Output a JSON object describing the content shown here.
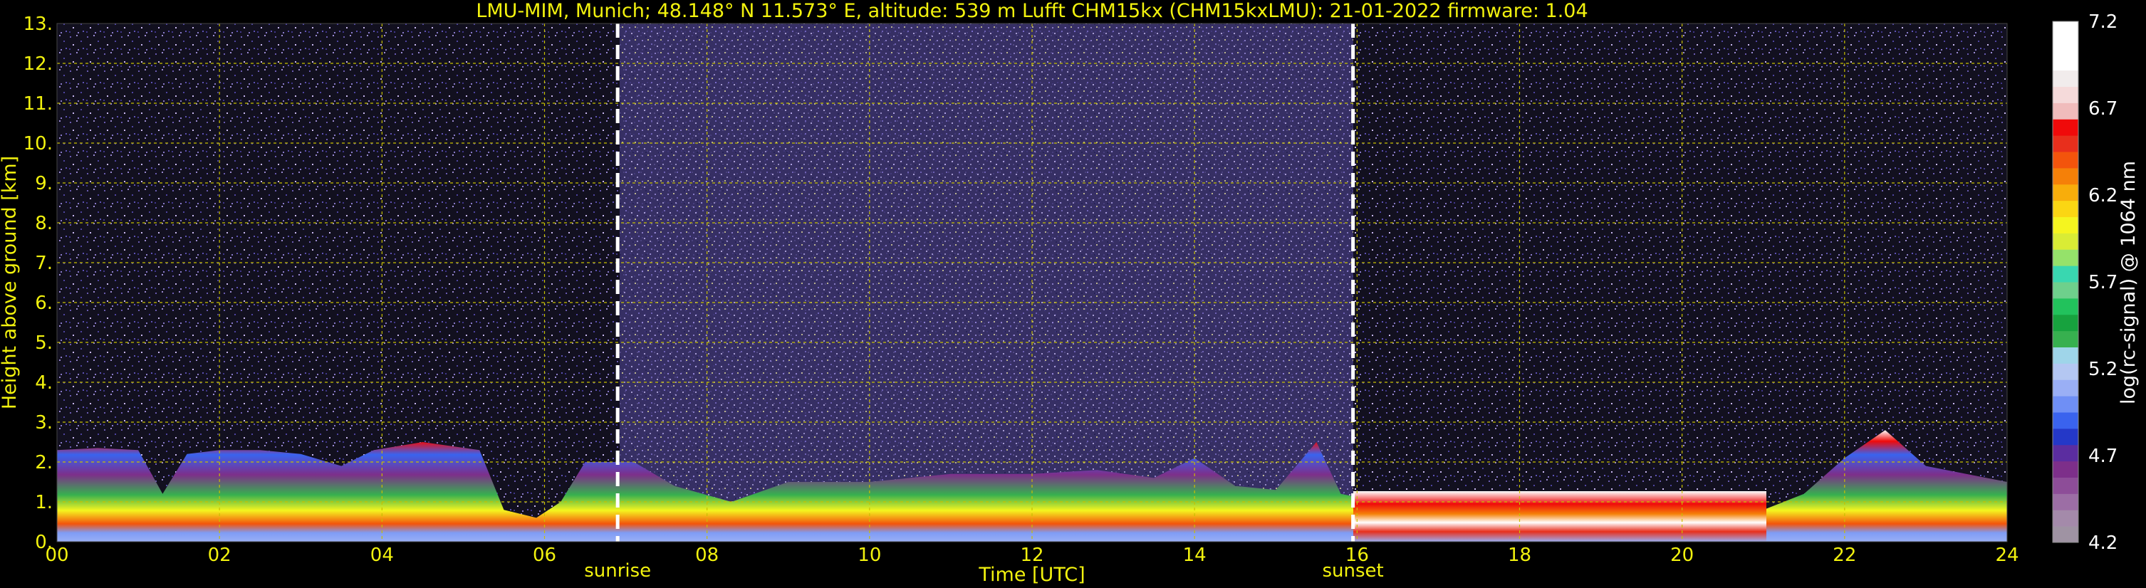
{
  "chart_data": {
    "type": "heatmap",
    "title": "LMU-MIM, Munich; 48.148° N 11.573° E, altitude: 539 m    Lufft CHM15kx (CHM15kxLMU): 21-01-2022    firmware: 1.04",
    "xlabel": "Time [UTC]",
    "ylabel": "Height above ground [km]",
    "xlim": [
      0,
      24
    ],
    "ylim": [
      0,
      13
    ],
    "x_ticks": [
      "00",
      "02",
      "04",
      "06",
      "08",
      "10",
      "12",
      "14",
      "16",
      "18",
      "20",
      "22",
      "24"
    ],
    "y_ticks": [
      "0.",
      "1.",
      "2.",
      "3.",
      "4.",
      "5.",
      "6.",
      "7.",
      "8.",
      "9.",
      "10.",
      "11.",
      "12.",
      "13."
    ],
    "grid": true,
    "annotations": [
      {
        "x": 6.9,
        "label": "sunrise"
      },
      {
        "x": 15.95,
        "label": "sunset"
      }
    ],
    "colorbar": {
      "label": "log(rc-signal) @ 1064 nm",
      "range": [
        4.2,
        7.2
      ],
      "ticks": [
        "4.2",
        "4.7",
        "5.2",
        "5.7",
        "6.2",
        "6.7",
        "7.2"
      ],
      "colors": [
        "#9f93a3",
        "#a48aaa",
        "#9c6ea5",
        "#8d4d98",
        "#7d2f8a",
        "#5b2da0",
        "#2438c8",
        "#3a63ee",
        "#6f8ff5",
        "#9aaff5",
        "#b4c7f2",
        "#9fd5e9",
        "#37b04f",
        "#17a23e",
        "#22c25c",
        "#6ed08c",
        "#39d7b0",
        "#95e26a",
        "#d9ec35",
        "#f5f51f",
        "#fbd613",
        "#f8ad0b",
        "#f58008",
        "#f3540c",
        "#e82f1c",
        "#f00a0a",
        "#f0bcbc",
        "#f5dada",
        "#f1ecec",
        "#ffffff",
        "#ffffff",
        "#ffffff"
      ]
    },
    "boundary_layer_top_km": [
      [
        0.0,
        2.3
      ],
      [
        0.5,
        2.35
      ],
      [
        1.0,
        2.3
      ],
      [
        1.3,
        1.2
      ],
      [
        1.6,
        2.2
      ],
      [
        2.0,
        2.3
      ],
      [
        2.5,
        2.3
      ],
      [
        3.0,
        2.2
      ],
      [
        3.5,
        1.9
      ],
      [
        3.9,
        2.3
      ],
      [
        4.5,
        2.5
      ],
      [
        5.2,
        2.3
      ],
      [
        5.5,
        0.8
      ],
      [
        5.9,
        0.6
      ],
      [
        6.2,
        1.0
      ],
      [
        6.5,
        2.0
      ],
      [
        7.1,
        2.0
      ],
      [
        7.6,
        1.4
      ],
      [
        8.3,
        1.0
      ],
      [
        9.0,
        1.5
      ],
      [
        10.0,
        1.5
      ],
      [
        11.0,
        1.7
      ],
      [
        12.0,
        1.7
      ],
      [
        12.8,
        1.8
      ],
      [
        13.5,
        1.6
      ],
      [
        14.0,
        2.1
      ],
      [
        14.5,
        1.4
      ],
      [
        15.0,
        1.3
      ],
      [
        15.5,
        2.5
      ],
      [
        15.8,
        1.2
      ],
      [
        16.3,
        1.0
      ],
      [
        17.0,
        1.0
      ],
      [
        18.0,
        0.9
      ],
      [
        19.0,
        0.9
      ],
      [
        20.0,
        0.8
      ],
      [
        21.0,
        0.8
      ],
      [
        21.5,
        1.2
      ],
      [
        22.0,
        2.1
      ],
      [
        22.5,
        2.8
      ],
      [
        23.0,
        1.9
      ],
      [
        24.0,
        1.5
      ]
    ]
  }
}
